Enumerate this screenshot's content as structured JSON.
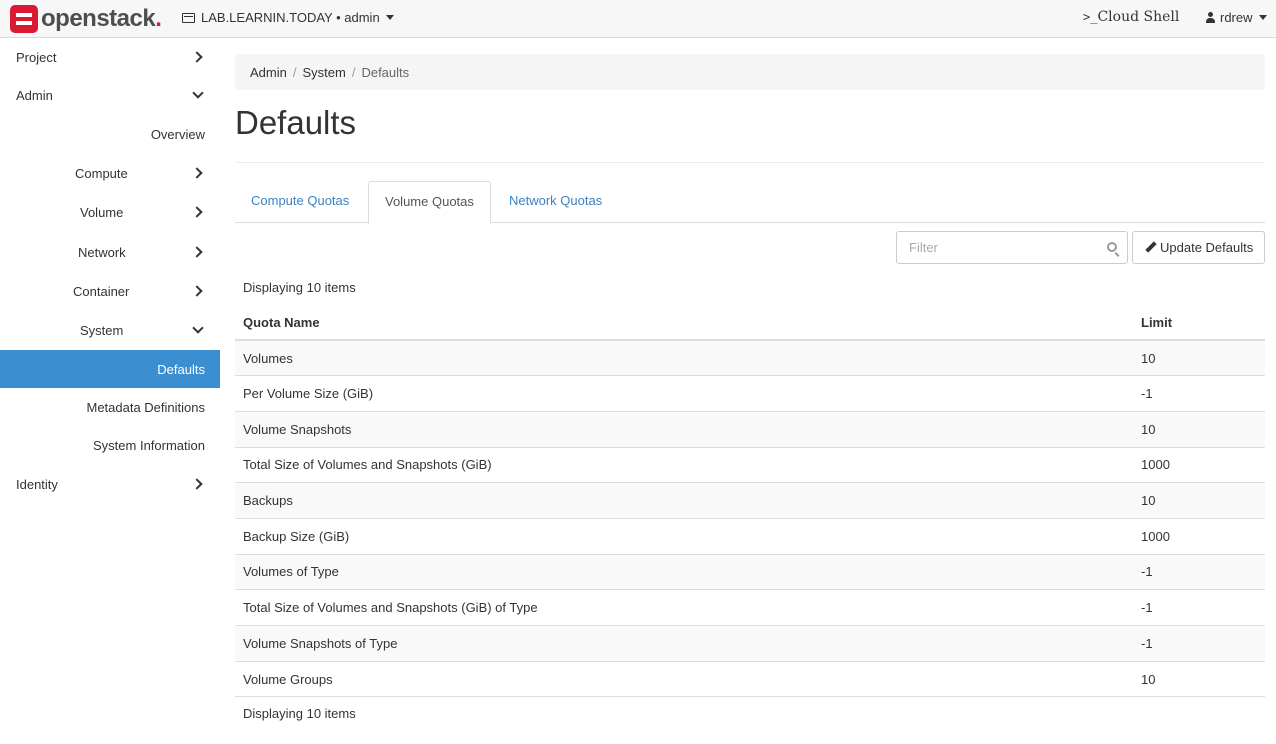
{
  "brand": {
    "name": "openstack",
    "dot": "."
  },
  "topbar": {
    "project_switcher": "LAB.LEARNIN.TODAY • admin",
    "cloud_shell_prompt": ">_",
    "cloud_shell_label": "Cloud Shell",
    "user": "rdrew"
  },
  "sidebar": {
    "project": "Project",
    "admin": "Admin",
    "overview": "Overview",
    "compute": "Compute",
    "volume": "Volume",
    "network": "Network",
    "container": "Container",
    "system": "System",
    "defaults": "Defaults",
    "metadata_definitions": "Metadata Definitions",
    "system_information": "System Information",
    "identity": "Identity"
  },
  "breadcrumb": {
    "admin": "Admin",
    "system": "System",
    "current": "Defaults",
    "separator": "/"
  },
  "page_title": "Defaults",
  "tabs": [
    "Compute Quotas",
    "Volume Quotas",
    "Network Quotas"
  ],
  "active_tab": "Volume Quotas",
  "filter": {
    "placeholder": "Filter"
  },
  "update_button": "Update Defaults",
  "table": {
    "count_label": "Displaying 10 items",
    "headers": {
      "name": "Quota Name",
      "limit": "Limit"
    },
    "rows": [
      {
        "name": "Volumes",
        "limit": "10"
      },
      {
        "name": "Per Volume Size (GiB)",
        "limit": "-1"
      },
      {
        "name": "Volume Snapshots",
        "limit": "10"
      },
      {
        "name": "Total Size of Volumes and Snapshots (GiB)",
        "limit": "1000"
      },
      {
        "name": "Backups",
        "limit": "10"
      },
      {
        "name": "Backup Size (GiB)",
        "limit": "1000"
      },
      {
        "name": "Volumes of Type",
        "limit": "-1"
      },
      {
        "name": "Total Size of Volumes and Snapshots (GiB) of Type",
        "limit": "-1"
      },
      {
        "name": "Volume Snapshots of Type",
        "limit": "-1"
      },
      {
        "name": "Volume Groups",
        "limit": "10"
      }
    ]
  },
  "colors": {
    "accent": "#3b8fd1",
    "brand": "#da1a32",
    "link": "#3b82c4"
  }
}
